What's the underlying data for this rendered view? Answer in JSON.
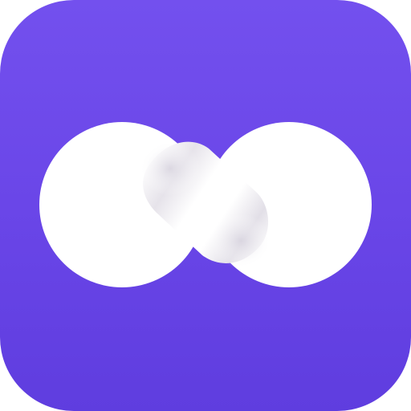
{
  "icon": {
    "name": "infinity-icon",
    "shape": "rounded-square app icon with white infinity symbol",
    "colors": {
      "background_top": "#7350ee",
      "background_bottom": "#5f3ddf",
      "symbol": "#ffffff",
      "shadow": "#cfcbd8"
    }
  }
}
